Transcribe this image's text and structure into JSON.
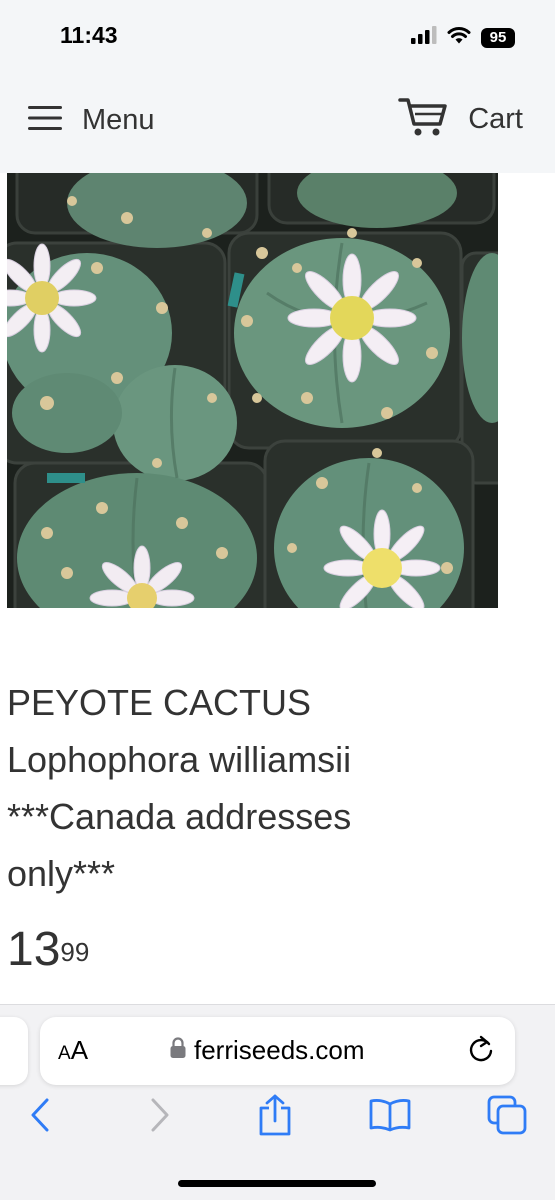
{
  "status_bar": {
    "time": "11:43",
    "battery_level": "95",
    "icons": [
      "cellular-signal-icon",
      "wifi-icon",
      "battery-icon"
    ]
  },
  "header": {
    "menu_label": "Menu",
    "cart_label": "Cart",
    "icons": [
      "hamburger-menu-icon",
      "shopping-cart-icon"
    ],
    "background_color": "#f4f6f8"
  },
  "product": {
    "image_subject": "peyote-cactus-photo",
    "title_lines": [
      "PEYOTE CACTUS",
      "Lophophora williamsii",
      "***Canada addresses",
      "only***"
    ],
    "price_whole": "13",
    "price_cents": "99"
  },
  "browser": {
    "text_size_label_small": "A",
    "text_size_label_large": "A",
    "url": "ferriseeds.com",
    "accent_color": "#2f7cf6",
    "icons": [
      "lock-icon",
      "reload-icon",
      "back-arrow-icon",
      "forward-arrow-icon",
      "share-icon",
      "bookmarks-icon",
      "tabs-icon"
    ]
  }
}
